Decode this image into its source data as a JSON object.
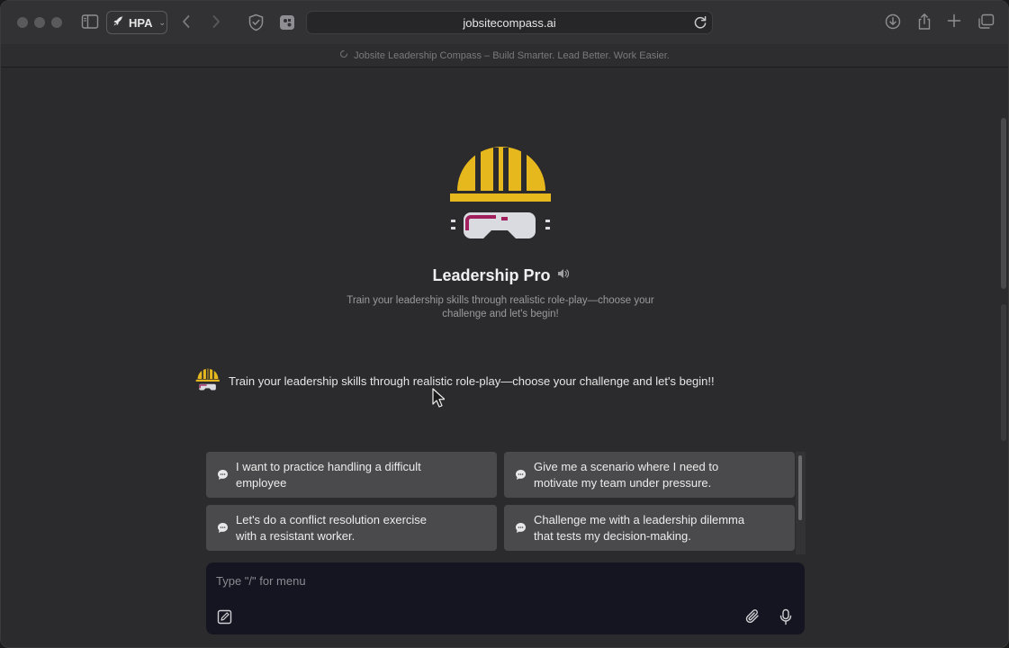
{
  "browser": {
    "profile_label": "HPA",
    "url": "jobsitecompass.ai",
    "tab_title": "Jobsite Leadership Compass – Build Smarter. Lead Better. Work Easier."
  },
  "hero": {
    "title": "Leadership Pro",
    "subtitle": "Train your leadership skills through realistic role-play—choose your challenge and let's begin!"
  },
  "message": {
    "text": "Train your leadership skills through realistic role-play—choose your challenge and let's begin!!"
  },
  "suggestions": [
    {
      "line1": "I want to practice handling a difficult",
      "line2": "employee"
    },
    {
      "line1": "Give me a scenario where I need to",
      "line2": "motivate my team under pressure."
    },
    {
      "line1": "Let's do a conflict resolution exercise",
      "line2": "with a resistant worker."
    },
    {
      "line1": "Challenge me with a leadership dilemma",
      "line2": "that tests my decision-making."
    }
  ],
  "composer": {
    "placeholder": "Type \"/\" for menu"
  },
  "colors": {
    "helmet": "#e6b81e",
    "goggles": "#d9dbe1",
    "accent_stripe": "#a11f5c"
  }
}
